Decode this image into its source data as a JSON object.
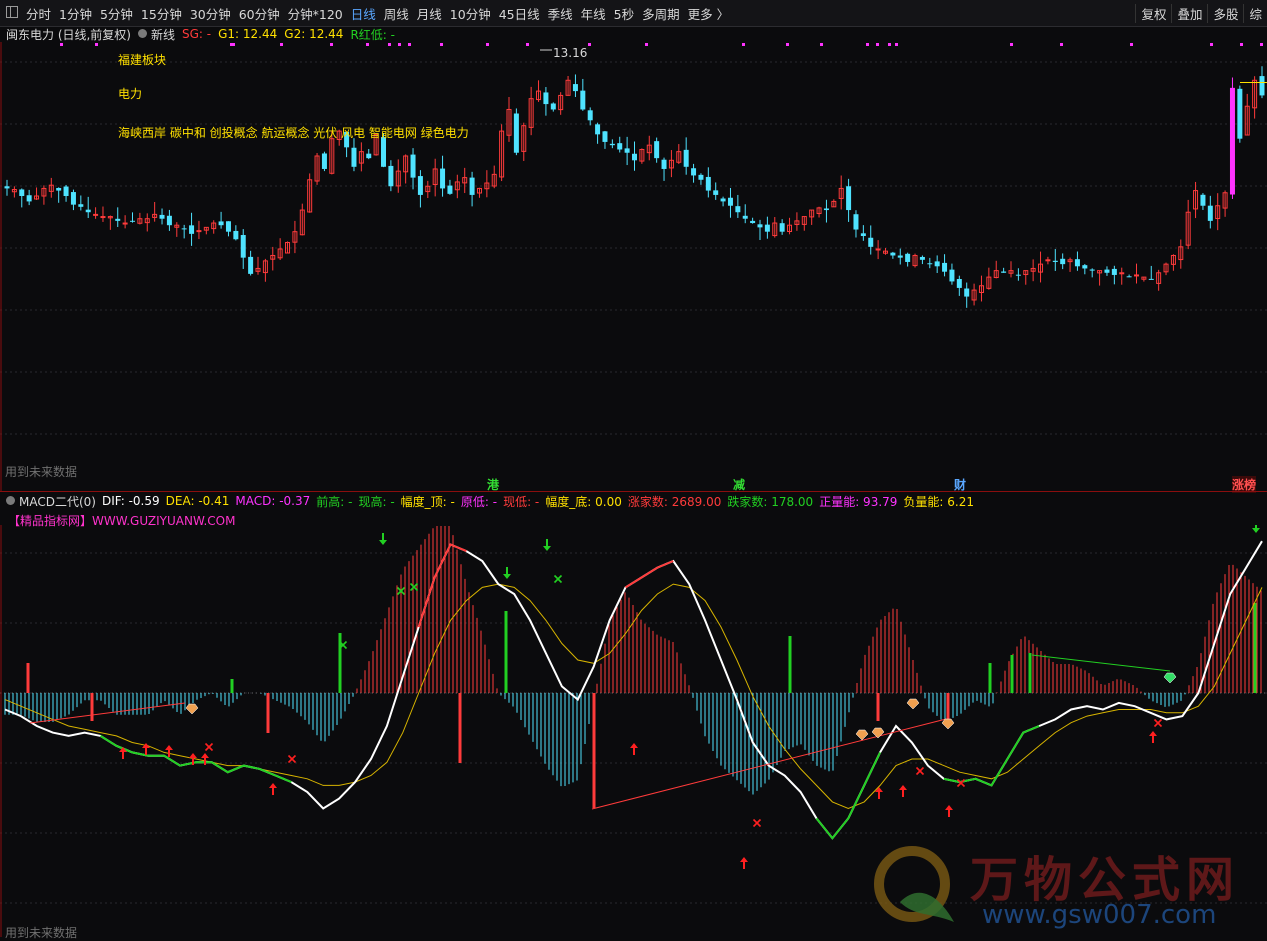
{
  "toolbar": {
    "periods": [
      "分时",
      "1分钟",
      "5分钟",
      "15分钟",
      "30分钟",
      "60分钟",
      "分钟*120",
      "日线",
      "周线",
      "月线",
      "10分钟",
      "45日线",
      "季线",
      "年线",
      "5秒",
      "多周期",
      "更多 〉"
    ],
    "active_period": "日线",
    "tools": [
      "复权",
      "叠加",
      "多股",
      "综"
    ]
  },
  "main_header": {
    "stock": "闽东电力 (日线,前复权)",
    "indicator": "新线",
    "sg": "SG: -",
    "g1": "G1: 12.44",
    "g2": "G2: 12.44",
    "r": "R红低: -"
  },
  "annotations": {
    "sector": "福建板块",
    "industry": "电力",
    "concepts": "海峡西岸 碳中和 创投概念 航运概念 光伏 风电 智能电网 绿色电力",
    "peak_label": "13.16",
    "footer_main": "用到未来数据",
    "footer_macd": "用到未来数据"
  },
  "events": [
    {
      "text": "港",
      "color": "#33dd33"
    },
    {
      "text": "减",
      "color": "#33dd33"
    },
    {
      "text": "财",
      "color": "#5aa7ff"
    },
    {
      "text": "涨榜",
      "color": "#ff5050"
    }
  ],
  "macd_header": {
    "name": "MACD二代(0)",
    "dif": "DIF: -0.59",
    "dea": "DEA: -0.41",
    "macd": "MACD: -0.37",
    "prev_high": "前高: -",
    "now_high": "现高: -",
    "amp_top": "幅度_顶: -",
    "orig_low": "原低: -",
    "now_low": "现低: -",
    "amp_bottom": "幅度_底: 0.00",
    "up_count": "涨家数: 2689.00",
    "down_count": "跌家数: 178.00",
    "pos_energy": "正量能: 93.79",
    "neg_energy": "负量能: 6.21"
  },
  "promo": "【精品指标网】WWW.GUZIYUANW.COM",
  "watermark": {
    "cn": "万物公式网",
    "url": "www.gsw007.com"
  },
  "colors": {
    "up": "#ff3b3b",
    "down": "#4fe3ff",
    "limit_up": "#ff33ff",
    "dif": "#ffffff",
    "dea": "#d7b400",
    "green": "#22d022"
  },
  "chart_data": {
    "type": "candlestick",
    "price_close": [
      12.02,
      12.01,
      11.95,
      11.9,
      11.95,
      12.02,
      12.05,
      12.0,
      11.95,
      11.87,
      11.85,
      11.8,
      11.78,
      11.76,
      11.76,
      11.72,
      11.7,
      11.72,
      11.74,
      11.74,
      11.78,
      11.74,
      11.68,
      11.68,
      11.65,
      11.6,
      11.63,
      11.66,
      11.7,
      11.68,
      11.62,
      11.55,
      11.38,
      11.23,
      11.28,
      11.35,
      11.4,
      11.46,
      11.52,
      11.62,
      11.82,
      12.1,
      12.32,
      12.2,
      12.48,
      12.55,
      12.4,
      12.22,
      12.36,
      12.3,
      12.52,
      12.22,
      12.04,
      12.18,
      12.32,
      12.12,
      11.96,
      12.04,
      12.2,
      12.02,
      11.97,
      12.08,
      12.12,
      11.96,
      12.02,
      12.07,
      12.15,
      12.55,
      12.75,
      12.35,
      12.6,
      12.85,
      12.92,
      12.8,
      12.75,
      12.88,
      13.02,
      12.92,
      12.75,
      12.65,
      12.52,
      12.45,
      12.42,
      12.38,
      12.35,
      12.28,
      12.38,
      12.42,
      12.3,
      12.2,
      12.28,
      12.36,
      12.22,
      12.14,
      12.1,
      12.0,
      11.96,
      11.9,
      11.86,
      11.8,
      11.74,
      11.7,
      11.66,
      11.62,
      11.7,
      11.62,
      11.68,
      11.72,
      11.76,
      11.82,
      11.84,
      11.82,
      11.9,
      12.02,
      11.82,
      11.64,
      11.58,
      11.48,
      11.46,
      11.44,
      11.4,
      11.38,
      11.34,
      11.4,
      11.36,
      11.32,
      11.3,
      11.25,
      11.16,
      11.1,
      11.02,
      11.08,
      11.12,
      11.2,
      11.26,
      11.24,
      11.26,
      11.22,
      11.26,
      11.28,
      11.32,
      11.36,
      11.34,
      11.32,
      11.36,
      11.3,
      11.28,
      11.26,
      11.26,
      11.24,
      11.22,
      11.24,
      11.2,
      11.22,
      11.2,
      11.18,
      11.24,
      11.32,
      11.4,
      11.48,
      11.8,
      12.0,
      11.86,
      11.72,
      11.86,
      11.98,
      12.95,
      12.48,
      12.78,
      13.02,
      12.88
    ],
    "peak": 13.16,
    "g1": 12.44,
    "g2": 12.44,
    "macd_dif": [
      -0.05,
      -0.07,
      -0.1,
      -0.12,
      -0.13,
      -0.12,
      -0.13,
      -0.16,
      -0.18,
      -0.19,
      -0.19,
      -0.22,
      -0.21,
      -0.21,
      -0.24,
      -0.22,
      -0.23,
      -0.25,
      -0.27,
      -0.3,
      -0.35,
      -0.32,
      -0.27,
      -0.2,
      -0.1,
      0.05,
      0.2,
      0.35,
      0.45,
      0.43,
      0.4,
      0.33,
      0.3,
      0.22,
      0.12,
      0.02,
      -0.02,
      0.08,
      0.22,
      0.32,
      0.35,
      0.38,
      0.4,
      0.33,
      0.22,
      0.1,
      -0.02,
      -0.15,
      -0.22,
      -0.25,
      -0.3,
      -0.38,
      -0.44,
      -0.38,
      -0.28,
      -0.18,
      -0.1,
      -0.15,
      -0.22,
      -0.26,
      -0.27,
      -0.26,
      -0.28,
      -0.2,
      -0.12,
      -0.1,
      -0.08,
      -0.05,
      -0.04,
      -0.05,
      -0.03,
      -0.04,
      -0.06,
      -0.08,
      -0.07,
      0.0,
      0.15,
      0.3,
      0.38,
      0.46
    ],
    "macd_dea": [
      -0.02,
      -0.04,
      -0.06,
      -0.08,
      -0.1,
      -0.11,
      -0.12,
      -0.13,
      -0.15,
      -0.16,
      -0.18,
      -0.19,
      -0.2,
      -0.21,
      -0.22,
      -0.22,
      -0.23,
      -0.24,
      -0.25,
      -0.26,
      -0.28,
      -0.28,
      -0.27,
      -0.25,
      -0.21,
      -0.12,
      0.0,
      0.12,
      0.22,
      0.28,
      0.32,
      0.33,
      0.32,
      0.28,
      0.22,
      0.15,
      0.1,
      0.09,
      0.12,
      0.18,
      0.25,
      0.3,
      0.33,
      0.32,
      0.28,
      0.2,
      0.1,
      -0.01,
      -0.1,
      -0.17,
      -0.23,
      -0.28,
      -0.33,
      -0.35,
      -0.33,
      -0.28,
      -0.22,
      -0.2,
      -0.2,
      -0.22,
      -0.24,
      -0.25,
      -0.26,
      -0.24,
      -0.2,
      -0.16,
      -0.12,
      -0.09,
      -0.07,
      -0.06,
      -0.05,
      -0.05,
      -0.05,
      -0.06,
      -0.06,
      -0.04,
      0.02,
      0.12,
      0.22,
      0.32
    ]
  }
}
